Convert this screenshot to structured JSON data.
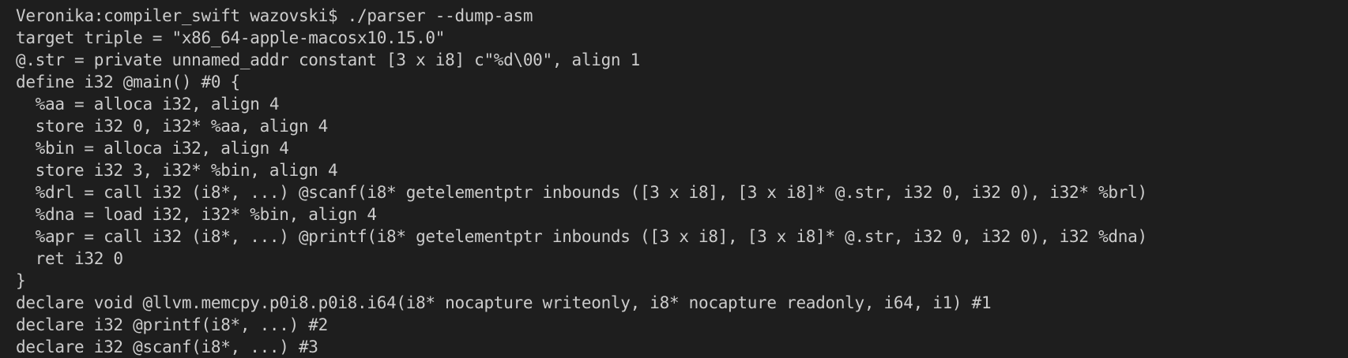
{
  "terminal": {
    "lines": [
      "Veronika:compiler_swift wazovski$ ./parser --dump-asm",
      "target triple = \"x86_64-apple-macosx10.15.0\"",
      "@.str = private unnamed_addr constant [3 x i8] c\"%d\\00\", align 1",
      "define i32 @main() #0 {",
      "  %aa = alloca i32, align 4",
      "  store i32 0, i32* %aa, align 4",
      "  %bin = alloca i32, align 4",
      "  store i32 3, i32* %bin, align 4",
      "  %drl = call i32 (i8*, ...) @scanf(i8* getelementptr inbounds ([3 x i8], [3 x i8]* @.str, i32 0, i32 0), i32* %brl)",
      "  %dna = load i32, i32* %bin, align 4",
      "  %apr = call i32 (i8*, ...) @printf(i8* getelementptr inbounds ([3 x i8], [3 x i8]* @.str, i32 0, i32 0), i32 %dna)",
      "  ret i32 0",
      "}",
      "declare void @llvm.memcpy.p0i8.p0i8.i64(i8* nocapture writeonly, i8* nocapture readonly, i64, i1) #1",
      "declare i32 @printf(i8*, ...) #2",
      "declare i32 @scanf(i8*, ...) #3"
    ]
  }
}
